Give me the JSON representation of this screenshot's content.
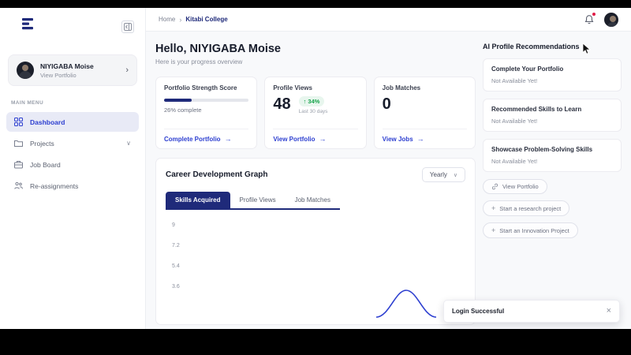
{
  "icons": {
    "breadcrumb_sep": "›",
    "chevron_right": "›",
    "chevron_down": "∨",
    "arrow_right": "→",
    "plus": "+",
    "up_arrow": "↑",
    "close": "×"
  },
  "colors": {
    "navy": "#1f2a7a",
    "link_blue": "#2d3fd0",
    "green": "#16a34a",
    "green_bg": "#e8f6ee",
    "active_bg": "#e8eaf6"
  },
  "header": {
    "breadcrumb": {
      "home": "Home",
      "current": "Kitabi College"
    }
  },
  "sidebar": {
    "profile": {
      "name": "NIYIGABA Moise",
      "subtitle": "View Portfolio"
    },
    "menu_label": "MAIN MENU",
    "items": [
      {
        "label": "Dashboard"
      },
      {
        "label": "Projects"
      },
      {
        "label": "Job Board"
      },
      {
        "label": "Re-assignments"
      }
    ]
  },
  "main": {
    "greeting": "Hello, NIYIGABA Moise",
    "subtitle": "Here is your progress overview",
    "cards": [
      {
        "title": "Portfolio Strength Score",
        "progress_pct": 26,
        "progress_text": "26% complete",
        "link": "Complete Portfolio"
      },
      {
        "title": "Profile Views",
        "value": "48",
        "badge": "34%",
        "badge_caption": "Last 30 days",
        "link": "View Portfolio"
      },
      {
        "title": "Job Matches",
        "value": "0",
        "link": "View Jobs"
      }
    ],
    "graph": {
      "title": "Career Development Graph",
      "period": "Yearly",
      "tabs": [
        {
          "label": "Skills Acquired"
        },
        {
          "label": "Profile Views"
        },
        {
          "label": "Job Matches"
        }
      ],
      "y_ticks": [
        {
          "label": "9"
        },
        {
          "label": "7.2"
        },
        {
          "label": "5.4"
        },
        {
          "label": "3.6"
        }
      ]
    }
  },
  "recommendations": {
    "title": "AI Profile Recommendations",
    "cards": [
      {
        "title": "Complete Your Portfolio",
        "status": "Not Available Yet!"
      },
      {
        "title": "Recommended Skills to Learn",
        "status": "Not Available Yet!"
      },
      {
        "title": "Showcase Problem-Solving Skills",
        "status": "Not Available Yet!"
      }
    ],
    "actions": [
      {
        "label": "View Portfolio"
      },
      {
        "label": "Start a research project"
      },
      {
        "label": "Start an Innovation Project"
      }
    ]
  },
  "toast": {
    "message": "Login Successful"
  },
  "chart_data": {
    "type": "line",
    "title": "Career Development Graph",
    "active_tab": "Skills Acquired",
    "period": "Yearly",
    "ylabel": "",
    "y_ticks": [
      9,
      7.2,
      5.4,
      3.6
    ],
    "series": [
      {
        "name": "Skills Acquired",
        "values_visible": "single small peak (~1.8) near right edge; rest of plot clipped"
      }
    ]
  }
}
